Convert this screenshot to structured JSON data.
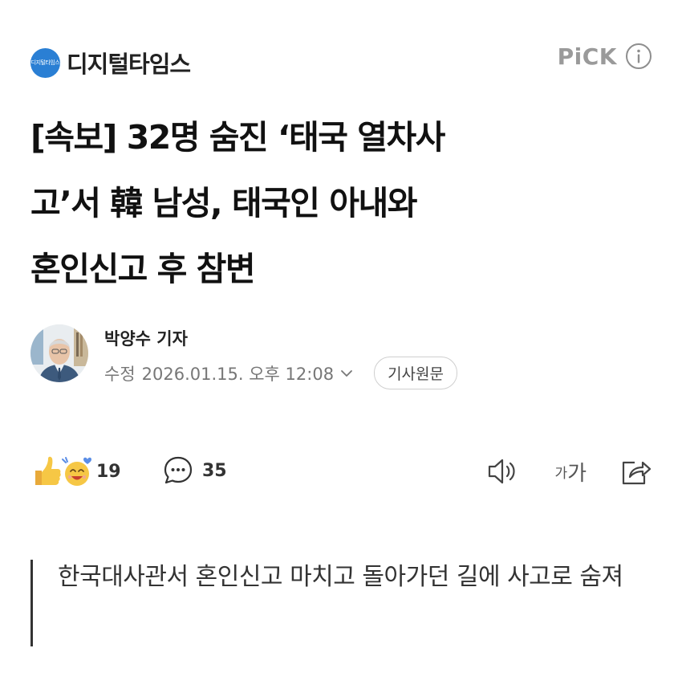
{
  "press": {
    "logo_text": "디지털타임스",
    "name": "디지털타임스"
  },
  "pick": {
    "label": "PiCK",
    "info_icon": "info-icon"
  },
  "headline": {
    "lines": [
      "[속보] 32명 숨진 ‘태국 열차사",
      "고’서 韓 남성, 태국인 아내와",
      "혼인신고 후 참변"
    ]
  },
  "byline": {
    "reporter": "박양수 기자",
    "modified_label": "수정",
    "datetime": "2026.01.15. 오후 12:08",
    "original_button": "기사원문"
  },
  "actions": {
    "reaction_count": "19",
    "comment_count": "35",
    "font_small": "가",
    "font_large": "가",
    "icons": [
      "thumbs-up-icon",
      "emoji-face-icon",
      "comment-icon",
      "speaker-icon",
      "share-icon"
    ]
  },
  "summary": {
    "text": "한국대사관서 혼인신고 마치고 돌아가던 길에 사고로 숨져"
  },
  "colors": {
    "logo_blue": "#2a7fd4",
    "pick_gray": "#9a9a9a",
    "text_dark": "#111111",
    "meta_gray": "#777777",
    "reaction_yellow": "#f6c745"
  }
}
